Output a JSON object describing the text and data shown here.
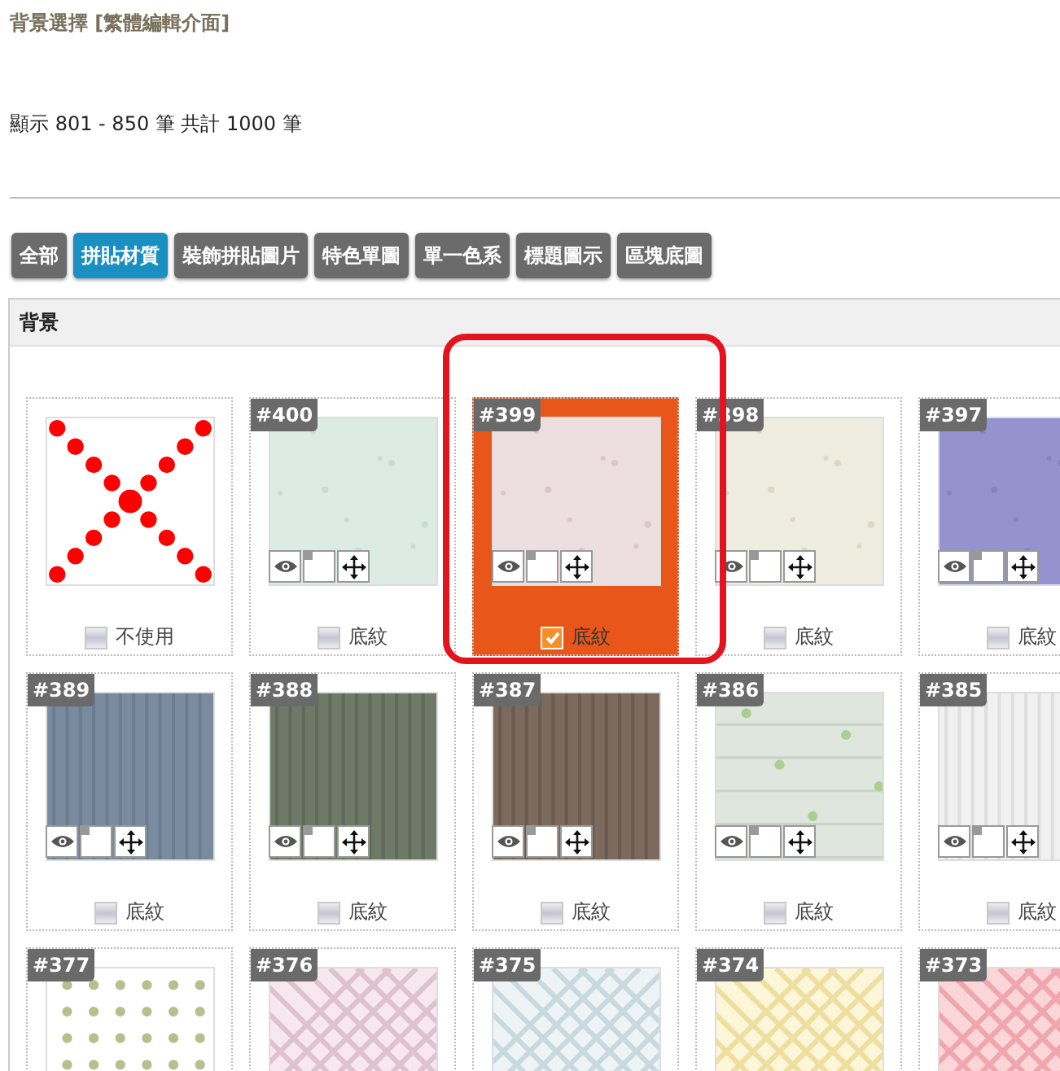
{
  "title": "背景選擇 [繁體編輯介面]",
  "count": "顯示 801 - 850 筆 共計 1000 筆",
  "tabs": [
    {
      "label": "全部",
      "selected": false
    },
    {
      "label": "拼貼材質",
      "selected": true
    },
    {
      "label": "裝飾拼貼圖片",
      "selected": false
    },
    {
      "label": "特色單圖",
      "selected": false
    },
    {
      "label": "單一色系",
      "selected": false
    },
    {
      "label": "標題圖示",
      "selected": false
    },
    {
      "label": "區塊底圖",
      "selected": false
    }
  ],
  "panel": {
    "title": "背景",
    "tiles": [
      {
        "kind": "none",
        "label": "不使用",
        "checked": false,
        "selected": false
      },
      {
        "kind": "texture",
        "number": "#400",
        "label": "底紋",
        "checked": false,
        "selected": false
      },
      {
        "kind": "texture",
        "number": "#399",
        "label": "底紋",
        "checked": true,
        "selected": true
      },
      {
        "kind": "texture",
        "number": "#398",
        "label": "底紋",
        "checked": false,
        "selected": false
      },
      {
        "kind": "texture",
        "number": "#397",
        "label": "底紋",
        "checked": false,
        "selected": false
      },
      {
        "kind": "texture",
        "number": "#389",
        "label": "底紋",
        "checked": false,
        "selected": false
      },
      {
        "kind": "texture",
        "number": "#388",
        "label": "底紋",
        "checked": false,
        "selected": false
      },
      {
        "kind": "texture",
        "number": "#387",
        "label": "底紋",
        "checked": false,
        "selected": false
      },
      {
        "kind": "texture",
        "number": "#386",
        "label": "底紋",
        "checked": false,
        "selected": false
      },
      {
        "kind": "texture",
        "number": "#385",
        "label": "底紋",
        "checked": false,
        "selected": false
      },
      {
        "kind": "texture",
        "number": "#377",
        "selected": false
      },
      {
        "kind": "texture",
        "number": "#376",
        "selected": false
      },
      {
        "kind": "texture",
        "number": "#375",
        "selected": false
      },
      {
        "kind": "texture",
        "number": "#374",
        "selected": false
      },
      {
        "kind": "texture",
        "number": "#373",
        "selected": false
      }
    ]
  }
}
